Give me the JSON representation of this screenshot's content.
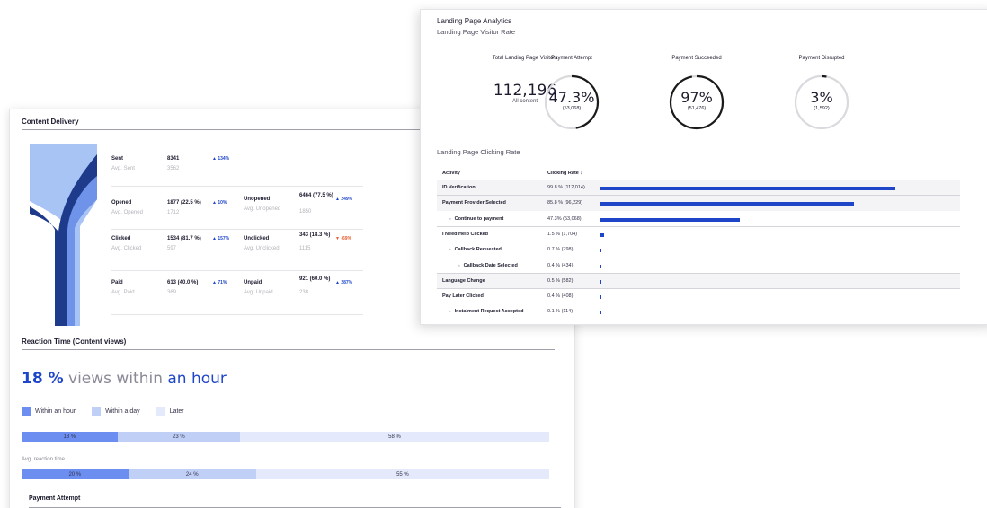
{
  "colors": {
    "accent": "#1f46c9",
    "funnel_dark": "#1e3a8a",
    "funnel_light": "#a8c4f5",
    "within_hour": "#6b8ef0",
    "within_day": "#c0cff5",
    "later": "#e4eafb"
  },
  "content_delivery": {
    "title": "Content Delivery",
    "metrics": [
      {
        "label": "Sent",
        "avg_label": "Avg. Sent",
        "value": "8341",
        "avg_value": "3562",
        "change": "▲ 134%",
        "direction": "up"
      },
      {
        "label": "Opened",
        "avg_label": "Avg. Opened",
        "value": "1877 (22.5 %)",
        "avg_value": "1712",
        "change": "▲ 10%",
        "direction": "up"
      },
      {
        "label": "Unopened",
        "avg_label": "Avg. Unopened",
        "value": "6464 (77.5 %)",
        "avg_value": "1850",
        "change": "▲ 249%",
        "direction": "up"
      },
      {
        "label": "Clicked",
        "avg_label": "Avg. Clicked",
        "value": "1534 (81.7 %)",
        "avg_value": "597",
        "change": "▲ 157%",
        "direction": "up"
      },
      {
        "label": "Unclicked",
        "avg_label": "Avg. Unclicked",
        "value": "343 (18.3 %)",
        "avg_value": "1115",
        "change": "▼ -69%",
        "direction": "down"
      },
      {
        "label": "Paid",
        "avg_label": "Avg. Paid",
        "value": "613 (40.0 %)",
        "avg_value": "369",
        "change": "▲ 71%",
        "direction": "up"
      },
      {
        "label": "Unpaid",
        "avg_label": "Avg. Unpaid",
        "value": "921 (60.0 %)",
        "avg_value": "238",
        "change": "▲ 287%",
        "direction": "up"
      }
    ]
  },
  "reaction_time": {
    "title": "Reaction Time (Content views)",
    "headline_value": "18 %",
    "headline_mid": " views within ",
    "headline_end": "an hour",
    "legend": [
      "Within an hour",
      "Within a day",
      "Later"
    ],
    "current": {
      "within_hour": 18,
      "within_day": 23,
      "later": 58,
      "labels": [
        "18 %",
        "23 %",
        "58 %"
      ]
    },
    "avg_label": "Avg. reaction time",
    "average": {
      "within_hour": 20,
      "within_day": 24,
      "later": 55,
      "labels": [
        "20 %",
        "24 %",
        "55 %"
      ]
    }
  },
  "payment_attempt": {
    "title": "Payment Attempt"
  },
  "landing_page": {
    "title": "Landing Page Analytics",
    "subtitle": "Landing Page Visitor Rate",
    "total_label": "Total Landing Page Visitors",
    "total_value": "112,196",
    "total_sub": "All content",
    "kpis": [
      {
        "label": "Payment Attempt",
        "value": "47.3%",
        "count": "(53,068)",
        "fraction": 0.473
      },
      {
        "label": "Payment Succeeded",
        "value": "97%",
        "count": "(51,476)",
        "fraction": 0.97
      },
      {
        "label": "Payment Disrupted",
        "value": "3%",
        "count": "(1,592)",
        "fraction": 0.03
      }
    ],
    "clicking_title": "Landing Page Clicking Rate",
    "col_activity": "Activity",
    "col_rate": "Clicking Rate ↓",
    "rows": [
      {
        "activity": "ID Verification",
        "rate": "99.8 % (112,014)",
        "pct": 99.8,
        "level": 0,
        "shaded": true,
        "sep": true
      },
      {
        "activity": "Payment Provider Selected",
        "rate": "85.8 % (96,229)",
        "pct": 85.8,
        "level": 0,
        "shaded": true,
        "sep": false
      },
      {
        "activity": "Continue to payment",
        "rate": "47.3% (53,068)",
        "pct": 47.3,
        "level": 1,
        "shaded": false,
        "sep": true
      },
      {
        "activity": "I Need Help Clicked",
        "rate": "1.5 % (1,704)",
        "pct": 1.5,
        "level": 0,
        "shaded": false,
        "sep": false
      },
      {
        "activity": "Callback Requested",
        "rate": "0.7 % (798)",
        "pct": 0.7,
        "level": 1,
        "shaded": false,
        "sep": false
      },
      {
        "activity": "Callback Date Selected",
        "rate": "0.4 % (434)",
        "pct": 0.4,
        "level": 2,
        "shaded": false,
        "sep": true
      },
      {
        "activity": "Language Change",
        "rate": "0.5 % (582)",
        "pct": 0.5,
        "level": 0,
        "shaded": true,
        "sep": true
      },
      {
        "activity": "Pay Later Clicked",
        "rate": "0.4 % (408)",
        "pct": 0.4,
        "level": 0,
        "shaded": false,
        "sep": false
      },
      {
        "activity": "Instalment Request Accepted",
        "rate": "0.1 % (114)",
        "pct": 0.1,
        "level": 1,
        "shaded": false,
        "sep": false
      }
    ]
  }
}
